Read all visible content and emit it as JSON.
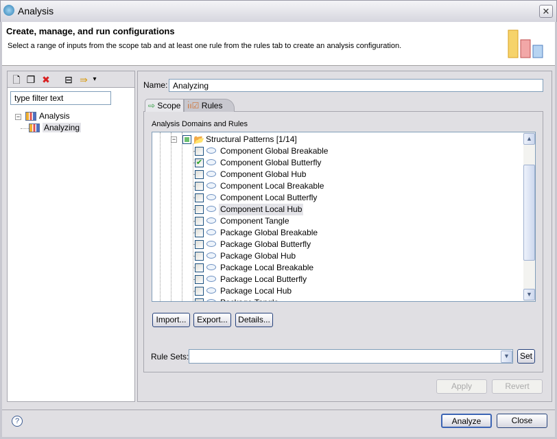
{
  "window": {
    "title": "Analysis",
    "close_glyph": "✕"
  },
  "header": {
    "title": "Create, manage, and run configurations",
    "description": "Select a range of inputs from the scope tab and at least one rule from the rules tab to create an analysis configuration."
  },
  "left": {
    "toolbar": [
      {
        "name": "new-configuration-icon",
        "glyph": "🗋"
      },
      {
        "name": "duplicate-icon",
        "glyph": "❐"
      },
      {
        "name": "delete-icon",
        "glyph": "✖"
      },
      {
        "name": "collapse-all-icon",
        "glyph": "⊟"
      },
      {
        "name": "filter-icon",
        "glyph": "⇛"
      },
      {
        "name": "view-menu-icon",
        "glyph": "▾"
      }
    ],
    "filter_placeholder": "type filter text",
    "tree": [
      {
        "label": "Analysis",
        "expander": "−"
      },
      {
        "label": "Analyzing"
      }
    ]
  },
  "main": {
    "name_label": "Name:",
    "name_value": "Analyzing",
    "tabs": [
      {
        "label": "Scope"
      },
      {
        "label": "Rules",
        "active": true
      }
    ],
    "section_label": "Analysis Domains and Rules",
    "group": {
      "label": "Structural Patterns [1/14]",
      "state": "partial"
    },
    "rules": [
      {
        "label": "Component Global Breakable",
        "checked": false
      },
      {
        "label": "Component Global Butterfly",
        "checked": true
      },
      {
        "label": "Component Global Hub",
        "checked": false
      },
      {
        "label": "Component Local Breakable",
        "checked": false
      },
      {
        "label": "Component Local Butterfly",
        "checked": false
      },
      {
        "label": "Component Local Hub",
        "checked": false,
        "selected": true
      },
      {
        "label": "Component Tangle",
        "checked": false
      },
      {
        "label": "Package Global Breakable",
        "checked": false
      },
      {
        "label": "Package Global Butterfly",
        "checked": false
      },
      {
        "label": "Package Global Hub",
        "checked": false
      },
      {
        "label": "Package Local Breakable",
        "checked": false
      },
      {
        "label": "Package Local Butterfly",
        "checked": false
      },
      {
        "label": "Package Local Hub",
        "checked": false
      },
      {
        "label": "Package Tangle",
        "checked": false
      }
    ],
    "buttons": {
      "import": "Import...",
      "export": "Export...",
      "details": "Details..."
    },
    "rule_sets_label": "Rule Sets:",
    "rule_sets_value": "",
    "set": "Set",
    "apply": "Apply",
    "revert": "Revert"
  },
  "footer": {
    "help_glyph": "?",
    "analyze": "Analyze",
    "close": "Close"
  },
  "colors": {
    "check": "#21a121",
    "selection": "#e3e3e8",
    "accent_border": "#24407a"
  }
}
